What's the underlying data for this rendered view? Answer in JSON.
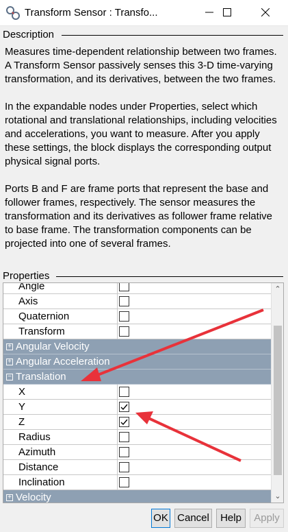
{
  "window": {
    "title": "Transform Sensor : Transfo...",
    "app_icon": "simulink-block-icon",
    "controls": [
      "minimize-icon",
      "maximize-icon",
      "close-icon"
    ]
  },
  "description": {
    "heading": "Description",
    "paragraphs": [
      "Measures time-dependent relationship between two frames. A Transform Sensor passively senses this 3-D time-varying transformation, and its derivatives, between the two frames.",
      "In the expandable nodes under Properties, select which rotational and translational relationships, including velocities and accelerations, you want to measure. After you apply these settings, the block displays the corresponding output physical signal ports.",
      "Ports B and F are frame ports that represent the base and follower frames, respectively. The sensor measures the transformation and its derivatives as follower frame relative to base frame. The transformation components can be projected into one of several frames."
    ]
  },
  "properties": {
    "heading": "Properties",
    "rows": [
      {
        "type": "item",
        "label": "Angle",
        "checked": false
      },
      {
        "type": "item",
        "label": "Axis",
        "checked": false
      },
      {
        "type": "item",
        "label": "Quaternion",
        "checked": false
      },
      {
        "type": "item",
        "label": "Transform",
        "checked": false
      },
      {
        "type": "group",
        "label": "Angular Velocity",
        "expanded": false
      },
      {
        "type": "group",
        "label": "Angular Acceleration",
        "expanded": false
      },
      {
        "type": "group",
        "label": "Translation",
        "expanded": true
      },
      {
        "type": "item",
        "label": "X",
        "checked": false
      },
      {
        "type": "item",
        "label": "Y",
        "checked": true
      },
      {
        "type": "item",
        "label": "Z",
        "checked": true
      },
      {
        "type": "item",
        "label": "Radius",
        "checked": false
      },
      {
        "type": "item",
        "label": "Azimuth",
        "checked": false
      },
      {
        "type": "item",
        "label": "Distance",
        "checked": false
      },
      {
        "type": "item",
        "label": "Inclination",
        "checked": false
      },
      {
        "type": "group",
        "label": "Velocity",
        "expanded": false
      }
    ],
    "group_color": "#8ea0b3"
  },
  "buttons": {
    "ok": "OK",
    "cancel": "Cancel",
    "help": "Help",
    "apply": "Apply"
  },
  "annotation_color": "#e8323a"
}
